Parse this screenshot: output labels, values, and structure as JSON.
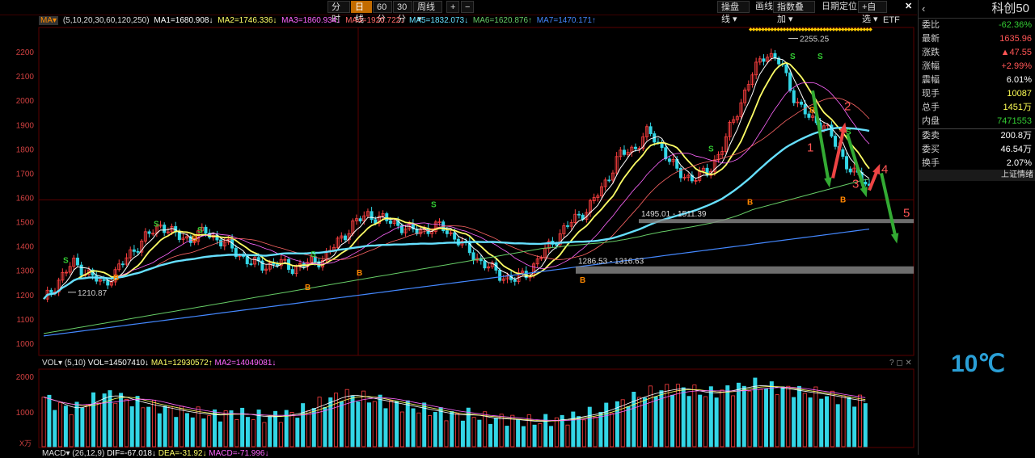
{
  "toolbar": {
    "period_buttons": [
      "分时",
      "日线",
      "60分",
      "30分",
      "周线 ▾"
    ],
    "active_period": "日线",
    "zoom_in": "+",
    "zoom_out": "−",
    "right_buttons": [
      "操盘线 ▾",
      "画线",
      "指数叠加 ▾",
      "日期定位",
      "+自选 ▾"
    ],
    "close": "✕"
  },
  "ma_legend": {
    "selector": "MA▾",
    "params": "(5,10,20,30,60,120,250)",
    "items": [
      {
        "text": "MA1=1680.908↓",
        "color": "#ffffff"
      },
      {
        "text": "MA2=1746.336↓",
        "color": "#ffff66"
      },
      {
        "text": "MA3=1860.934↓",
        "color": "#ff66ff"
      },
      {
        "text": "MA4=1920.722↓",
        "color": "#ff6666"
      },
      {
        "text": "MA5=1832.073↓",
        "color": "#66e0ff"
      },
      {
        "text": "MA6=1620.876↑",
        "color": "#66cc66"
      },
      {
        "text": "MA7=1470.171↑",
        "color": "#4488ff"
      }
    ]
  },
  "etf_label": "ETF",
  "vol_legend": {
    "selector": "VOL▾",
    "params": "(5,10)",
    "vol": "VOL=14507410↓",
    "ma1": "MA1=12930572↑",
    "ma2": "MA2=14049081↓"
  },
  "macd_legend": {
    "selector": "MACD▾",
    "params": "(26,12,9)",
    "dif": "DIF=-67.018↓",
    "dea": "DEA=-31.92↓",
    "macd": "MACD=-71.996↓"
  },
  "vol_unit": "X万",
  "panel": {
    "title": "科创50",
    "rows": [
      {
        "k": "委比",
        "v": "-62.36%",
        "color": "#33cc33"
      },
      {
        "k": "最新",
        "v": "1635.96",
        "color": "#ff5555"
      },
      {
        "k": "涨跌",
        "v": "▲47.55",
        "color": "#ff5555"
      },
      {
        "k": "涨幅",
        "v": "+2.99%",
        "color": "#ff5555"
      },
      {
        "k": "震幅",
        "v": "6.01%",
        "color": "#ffffff"
      },
      {
        "k": "现手",
        "v": "10087",
        "color": "#ffff55"
      },
      {
        "k": "总手",
        "v": "1451万",
        "color": "#ffff55"
      },
      {
        "k": "内盘",
        "v": "7471553",
        "color": "#33cc33"
      },
      {
        "k": "委卖",
        "v": "200.8万",
        "color": "#ffffff"
      },
      {
        "k": "委买",
        "v": "46.54万",
        "color": "#ffffff"
      },
      {
        "k": "换手",
        "v": "2.07%",
        "color": "#ffffff"
      }
    ],
    "section": "上证情绪"
  },
  "temperature": "10℃",
  "annotations": {
    "high": "2255.25",
    "low": "1210.87",
    "zone_upper": "1495.01 - 1511.39",
    "zone_lower": "1286.53 - 1316.63",
    "wave_labels": [
      "1",
      "2",
      "3",
      "4",
      "5"
    ],
    "s_marks": [
      "S",
      "S",
      "S",
      "S",
      "S",
      "S",
      "S",
      "S",
      "S"
    ],
    "b_marks": [
      "B",
      "B",
      "B",
      "B",
      "B",
      "B",
      "B",
      "B"
    ]
  },
  "chart_data": {
    "type": "candlestick",
    "y_axis_ticks": [
      2200,
      2100,
      2000,
      1900,
      1800,
      1700,
      1600,
      1500,
      1400,
      1300,
      1200,
      1100,
      1000
    ],
    "ylim": [
      950,
      2300
    ],
    "vol_axis_ticks": [
      2000,
      1000
    ],
    "close_path": [
      1170,
      1260,
      1330,
      1290,
      1240,
      1300,
      1380,
      1440,
      1490,
      1440,
      1430,
      1460,
      1420,
      1380,
      1330,
      1320,
      1330,
      1310,
      1330,
      1350,
      1420,
      1490,
      1530,
      1510,
      1490,
      1460,
      1470,
      1480,
      1430,
      1370,
      1320,
      1280,
      1260,
      1300,
      1380,
      1450,
      1510,
      1560,
      1650,
      1770,
      1800,
      1870,
      1800,
      1700,
      1680,
      1700,
      1800,
      1950,
      2100,
      2200,
      2150,
      2000,
      1920,
      1900,
      1780,
      1700,
      1640
    ],
    "highs": [
      {
        "label": "2255.25",
        "value": 2255.25
      }
    ],
    "lows": [
      {
        "label": "1210.87",
        "value": 1210.87
      }
    ],
    "zones": [
      {
        "label": "1495.01 - 1511.39",
        "from": 1495.01,
        "to": 1511.39
      },
      {
        "label": "1286.53 - 1316.63",
        "from": 1286.53,
        "to": 1316.63
      }
    ],
    "volume": [
      1600,
      1300,
      1200,
      1500,
      1700,
      1550,
      1400,
      1300,
      1200,
      1100,
      1050,
      1000,
      1100,
      1000,
      950,
      1000,
      1100,
      1300,
      1500,
      1700,
      1600,
      1500,
      1400,
      1300,
      1200,
      1100,
      1000,
      1050,
      900,
      900,
      850,
      800,
      850,
      900,
      1000,
      1100,
      1300,
      1500,
      1700,
      1800,
      1900,
      1800,
      1700,
      1800,
      1900,
      2000,
      1900,
      1850,
      1750,
      1700,
      1600,
      1500,
      1450
    ]
  }
}
